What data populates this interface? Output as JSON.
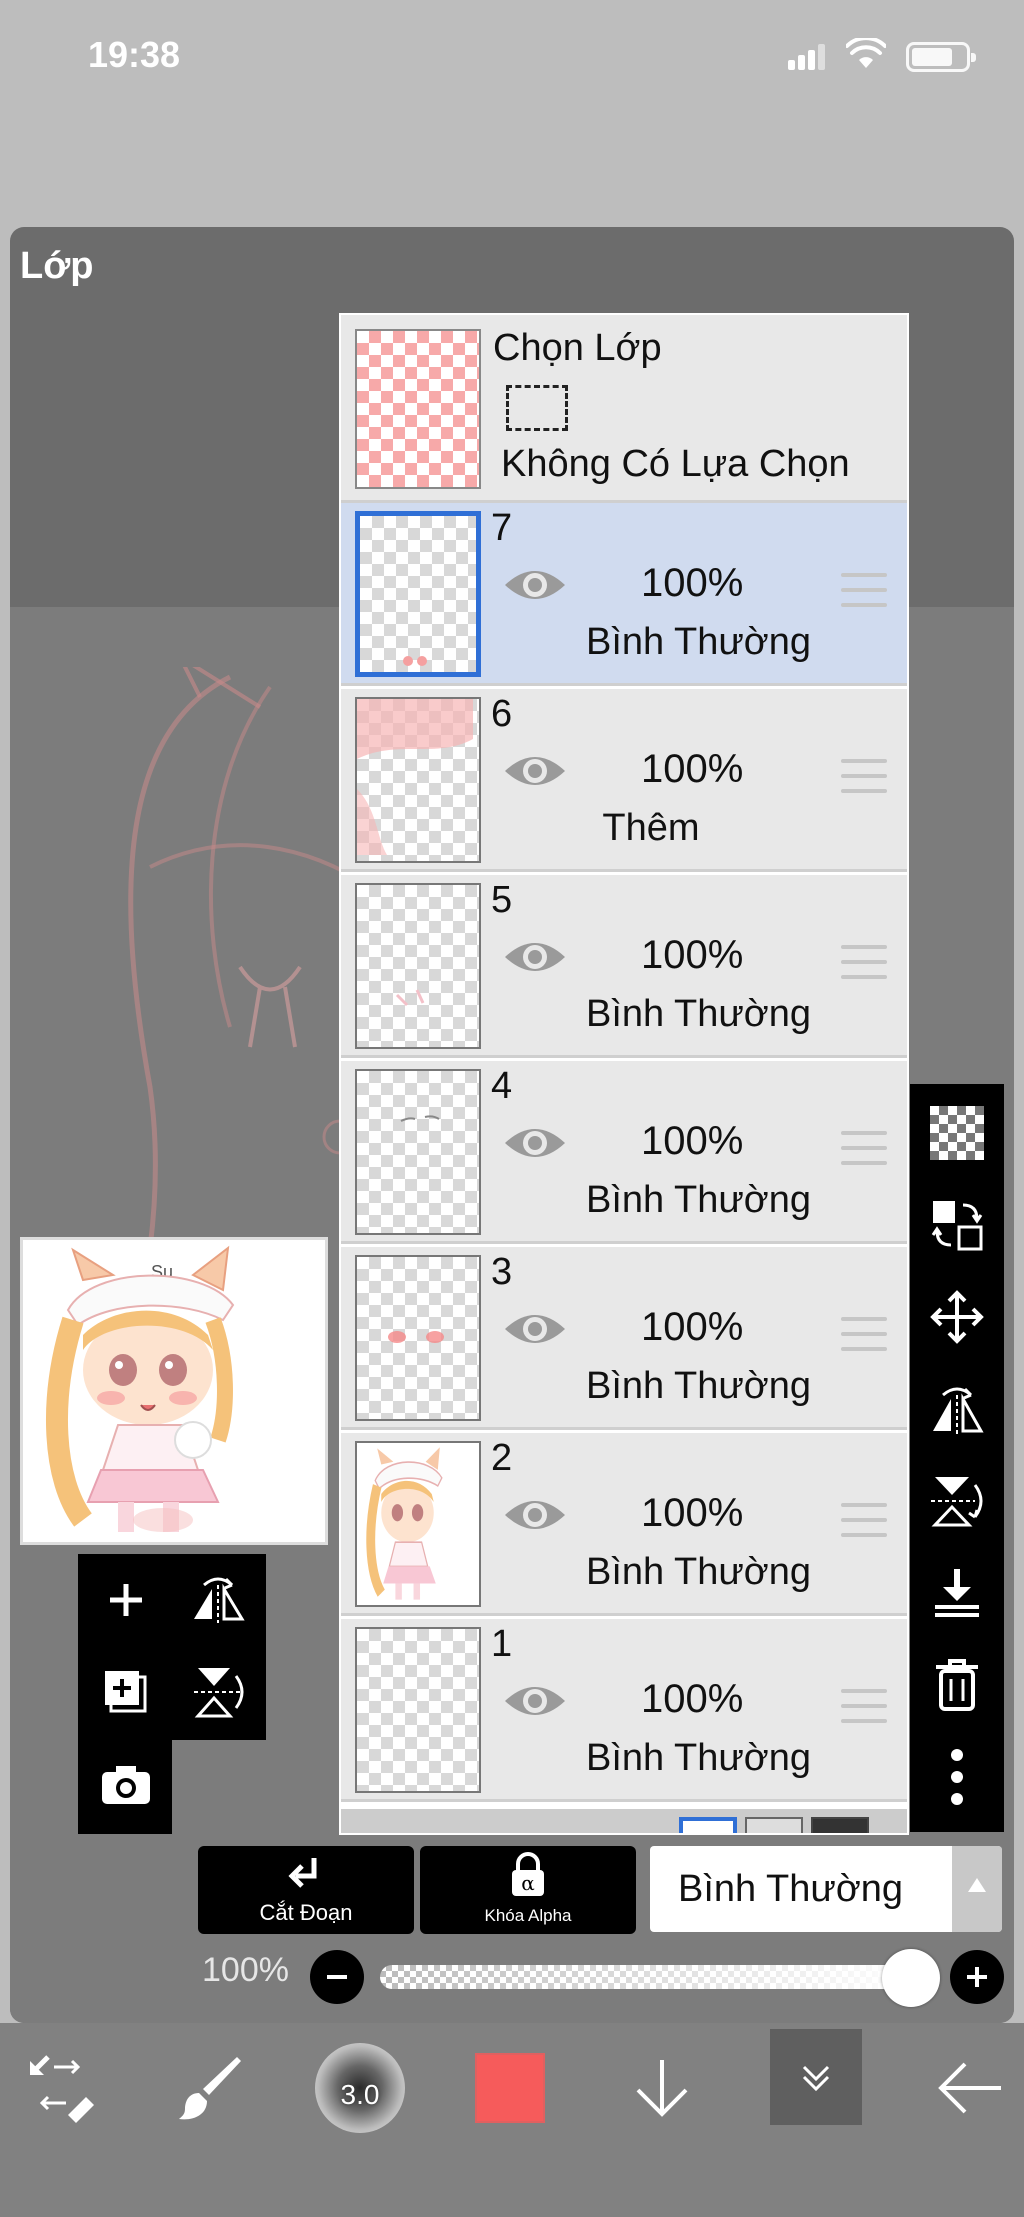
{
  "status_bar": {
    "time": "19:38"
  },
  "panel": {
    "title": "Lớp"
  },
  "selection_layer": {
    "title": "Chọn Lớp",
    "status": "Không Có Lựa Chọn"
  },
  "layers": [
    {
      "number": "7",
      "opacity": "100%",
      "blend": "Bình Thường",
      "active": true
    },
    {
      "number": "6",
      "opacity": "100%",
      "blend": "Thêm",
      "active": false
    },
    {
      "number": "5",
      "opacity": "100%",
      "blend": "Bình Thường",
      "active": false
    },
    {
      "number": "4",
      "opacity": "100%",
      "blend": "Bình Thường",
      "active": false
    },
    {
      "number": "3",
      "opacity": "100%",
      "blend": "Bình Thường",
      "active": false
    },
    {
      "number": "2",
      "opacity": "100%",
      "blend": "Bình Thường",
      "active": false
    },
    {
      "number": "1",
      "opacity": "100%",
      "blend": "Bình Thường",
      "active": false
    }
  ],
  "preview": {
    "watermark": "Su"
  },
  "buttons": {
    "clip_label": "Cắt Đoạn",
    "alpha_lock_label": "Khóa Alpha"
  },
  "blend_mode": {
    "selected": "Bình Thường"
  },
  "opacity": {
    "label": "100%",
    "value": 1.0
  },
  "brush": {
    "size": "3.0"
  },
  "colors": {
    "current": "#f65b5b",
    "selection_blue": "#2f6fd6"
  },
  "icons": {
    "left_tools": [
      "plus-icon",
      "flip-horizontal-icon",
      "add-layer-icon",
      "flip-vertical-icon",
      "camera-icon"
    ],
    "right_tools": [
      "transparency-icon",
      "swap-layer-icon",
      "move-icon",
      "flip-horizontal-icon",
      "flip-vertical-icon",
      "merge-down-icon",
      "trash-icon",
      "more-icon"
    ],
    "bottom_tools": [
      "transform-icon",
      "brush-icon",
      "brush-size",
      "color-swatch",
      "down-arrow-icon",
      "collapse-icon",
      "back-arrow-icon"
    ]
  }
}
